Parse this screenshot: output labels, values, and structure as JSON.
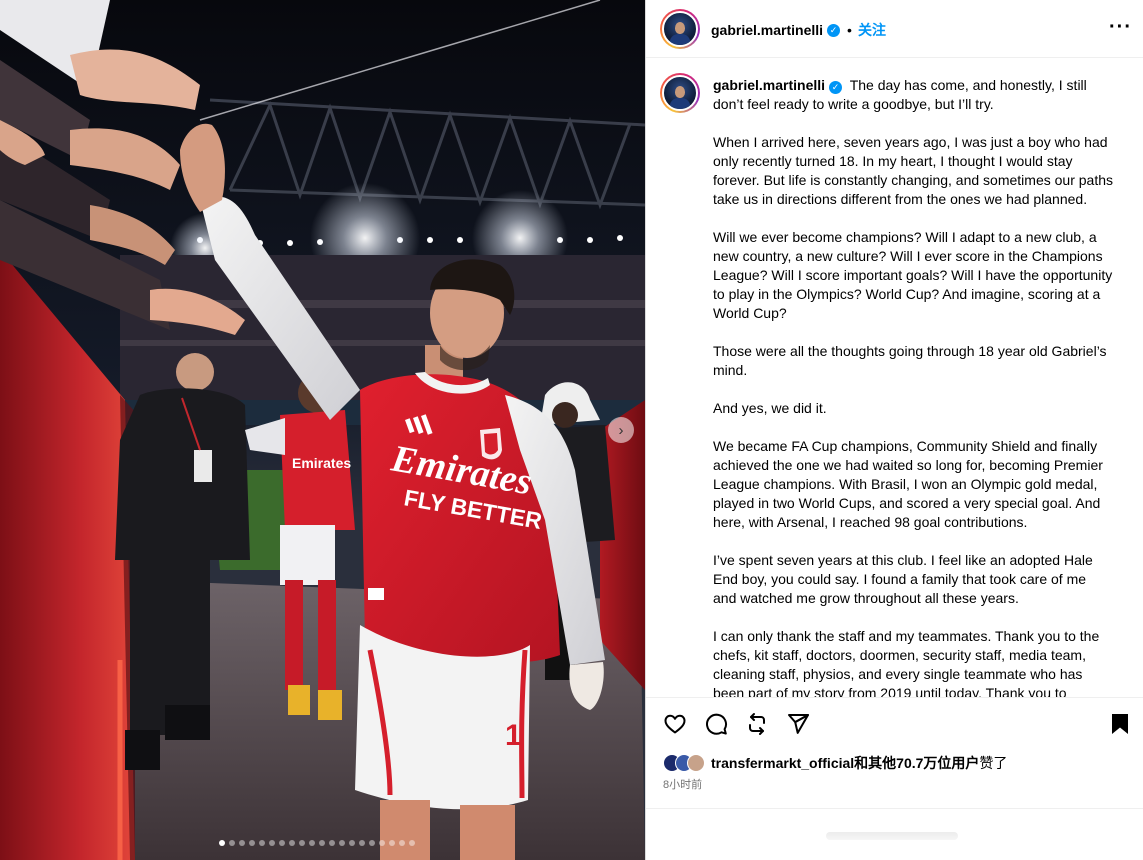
{
  "post": {
    "username": "gabriel.martinelli",
    "verified_mark": "✓",
    "separator": "•",
    "follow_label": "关注",
    "more_label": "···",
    "caption": [
      "The day has come, and honestly, I still don’t feel ready to write a goodbye, but I’ll try.",
      "When I arrived here, seven years ago, I was just a boy who had only recently turned 18. In my heart, I thought I would stay forever. But life is constantly changing, and sometimes our paths take us in directions different from the ones we had planned.",
      "Will we ever become champions? Will I adapt to a new club, a new country, a new culture? Will I ever score in the Champions League? Will I score important goals? Will I have the opportunity to play in the Olympics? World Cup? And imagine, scoring at a World Cup?",
      "Those were all the thoughts going through 18 year old Gabriel’s mind.",
      "And yes, we did it.",
      "We became FA Cup champions, Community Shield and finally achieved the one we had waited so long for, becoming Premier League champions. With Brasil, I won an Olympic gold medal, played in two World Cups, and scored a very special goal. And here, with Arsenal, I reached 98 goal contributions.",
      "I’ve spent seven years at this club. I feel like an adopted Hale End boy, you could say. I found a family that took care of me and watched me grow throughout all these years.",
      "I can only thank the staff and my teammates. Thank you to the chefs, kit staff, doctors, doormen, security staff, media team, cleaning staff, physios, and every single teammate who has been part of my story from 2019 until today. Thank you to everyone"
    ],
    "likes": {
      "first_user": "transfermarkt_official",
      "others_text": "和其他70.7万位用户",
      "suffix": "赞了"
    },
    "timestamp": "8小时前"
  },
  "photo": {
    "shirt_sponsor_line1": "Emirates",
    "shirt_sponsor_line2": "FLY BETTER",
    "next_icon": "chevron-right-icon",
    "carousel_total": 20,
    "carousel_active": 1
  },
  "colors": {
    "accent": "#0095f6",
    "arsenal_red": "#d8182c",
    "muted": "#737373"
  }
}
